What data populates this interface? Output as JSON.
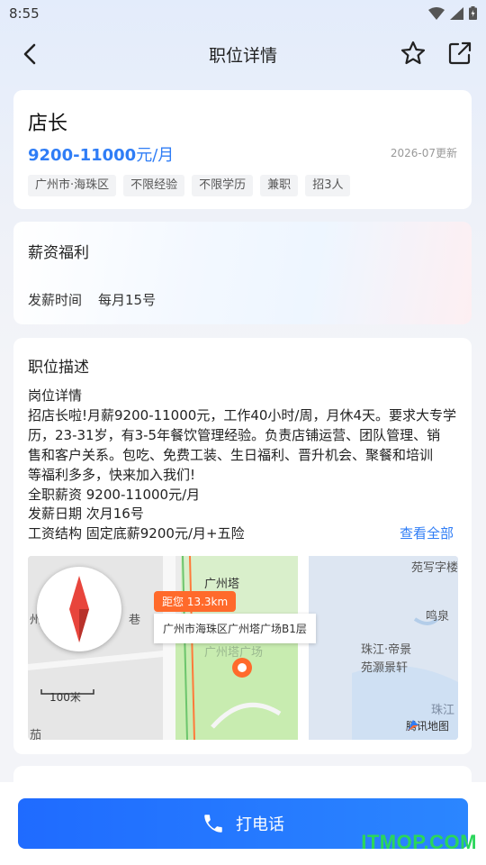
{
  "status_bar": {
    "time": "8:55"
  },
  "nav": {
    "title": "职位详情"
  },
  "job": {
    "title": "店长",
    "salary": "9200-11000",
    "salary_unit": "元/月",
    "updated": "2026-07更新",
    "tags": [
      "广州市·海珠区",
      "不限经验",
      "不限学历",
      "兼职",
      "招3人"
    ]
  },
  "salary_section": {
    "title": "薪资福利",
    "pay_label": "发薪时间",
    "pay_value": "每月15号"
  },
  "description": {
    "title": "职位描述",
    "lines": [
      "岗位详情",
      "招店长啦!月薪9200-11000元，工作40小时/周，月休4天。要求大专学",
      "历，23-31岁，有3-5年餐饮管理经验。负责店铺运营、团队管理、销",
      "售和客户关系。包吃、免费工装、生日福利、晋升机会、聚餐和培训",
      "等福利多多，快来加入我们!",
      "全职薪资 9200-11000元/月",
      "发薪日期 次月16号",
      "工资结构 固定底薪9200元/月+五险"
    ],
    "view_all": "查看全部"
  },
  "map": {
    "distance": "距您 13.3km",
    "address": "广州市海珠区广州塔广场B1层",
    "labels": {
      "tower": "广州塔",
      "garden": "苑写字楼",
      "mingquan": "鸣泉",
      "district_1": "珠江·帝景",
      "district_2": "苑灏景轩",
      "river": "珠江",
      "plaza": "广州塔广场",
      "left_1": "州",
      "left_2": "巷",
      "bottom_left": "茄"
    },
    "scale": "100米",
    "provider": "腾讯地图"
  },
  "bottom": {
    "call_label": "打电话"
  },
  "watermark": "ITMOP.COM",
  "colors": {
    "accent": "#2f7df6",
    "call_button": "#1f6bff",
    "distance_badge": "#ff6a2b",
    "watermark": "#2bd65b"
  }
}
